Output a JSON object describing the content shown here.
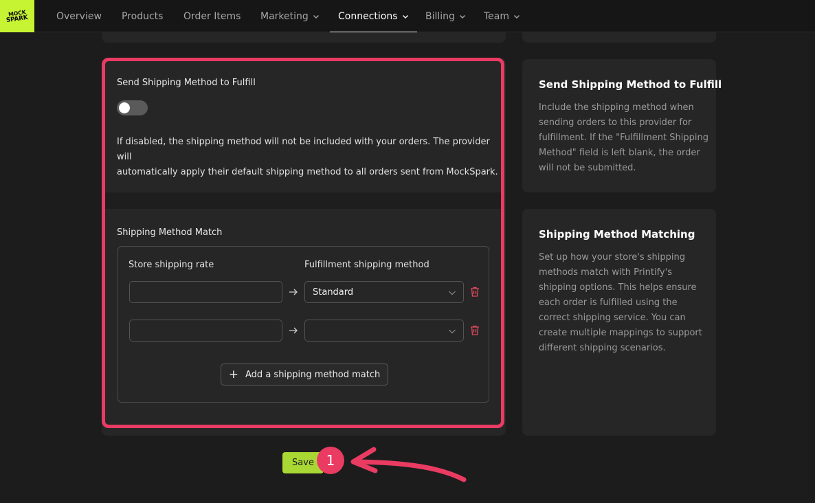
{
  "logo": {
    "line1": "MOCK",
    "line2": "SPARK"
  },
  "nav": {
    "items": [
      {
        "label": "Overview",
        "dropdown": false,
        "active": false
      },
      {
        "label": "Products",
        "dropdown": false,
        "active": false
      },
      {
        "label": "Order Items",
        "dropdown": false,
        "active": false
      },
      {
        "label": "Marketing",
        "dropdown": true,
        "active": false
      },
      {
        "label": "Connections",
        "dropdown": true,
        "active": true
      },
      {
        "label": "Billing",
        "dropdown": true,
        "active": false
      },
      {
        "label": "Team",
        "dropdown": true,
        "active": false
      }
    ]
  },
  "send_shipping": {
    "title": "Send Shipping Method to Fulfill",
    "toggle_on": false,
    "description": "If disabled, the shipping method will not be included with your orders. The provider will automatically apply their default shipping method to all orders sent from MockSpark.",
    "desc_line1": "If disabled, the shipping method will not be included with your orders. The provider will",
    "desc_line2": "automatically apply their default shipping method to all orders sent from MockSpark."
  },
  "matching": {
    "title": "Shipping Method Match",
    "col_store": "Store shipping rate",
    "col_fulfillment": "Fulfillment shipping method",
    "rows": [
      {
        "store_rate": "",
        "fulfillment_method": "Standard"
      },
      {
        "store_rate": "",
        "fulfillment_method": ""
      }
    ],
    "add_label": "Add a shipping method match"
  },
  "side_send": {
    "title": "Send Shipping Method to Fulfill",
    "lines": [
      "Include the shipping method when",
      "sending orders to this provider for",
      "fulfillment. If the \"Fulfillment Shipping",
      "Method\" field is left blank, the order",
      "will not be submitted."
    ]
  },
  "side_match": {
    "title": "Shipping Method Matching",
    "lines": [
      "Set up how your store's shipping",
      "methods match with Printify's",
      "shipping options. This helps ensure",
      "each order is fulfilled using the",
      "correct shipping service. You can",
      "create multiple mappings to support",
      "different shipping scenarios."
    ]
  },
  "save_label": "Save",
  "annotation": {
    "step": "1"
  },
  "colors": {
    "accent_green": "#a9d834",
    "logo_green": "#c6f432",
    "highlight": "#ea3b63",
    "trash": "#e0495e"
  },
  "icons": {
    "arrow": "arrow-right-icon",
    "trash": "trash-icon",
    "caret": "chevron-down-icon",
    "plus": "plus-icon"
  }
}
